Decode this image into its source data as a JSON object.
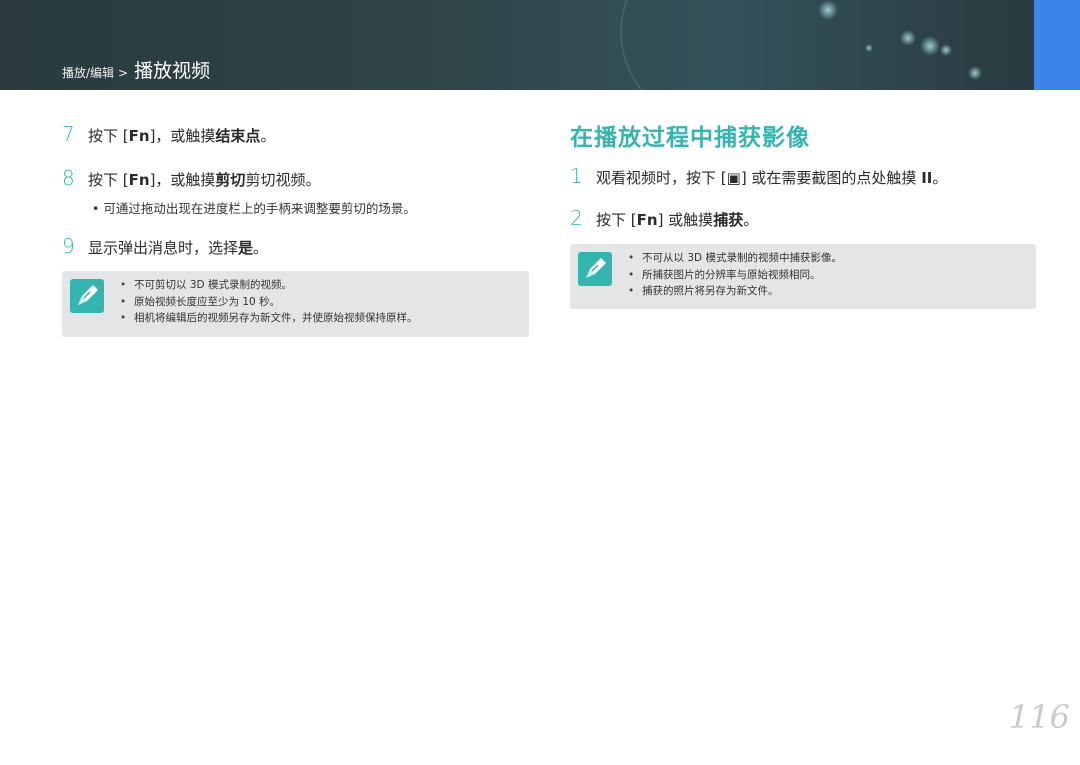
{
  "header": {
    "crumb": "播放/编辑",
    "separator": ">",
    "title": "播放视频"
  },
  "left": {
    "steps": [
      {
        "num": "7",
        "pre": "按下 [",
        "key": "Fn",
        "mid": "]，或触摸",
        "bold": "结束点",
        "post": "。"
      },
      {
        "num": "8",
        "pre": "按下 [",
        "key": "Fn",
        "mid": "]，或触摸",
        "bold": "剪切",
        "post": "剪切视频。"
      },
      {
        "num": "9",
        "pre": "显示弹出消息时，选择",
        "bold": "是",
        "post": "。"
      }
    ],
    "step8_sub": "• 可通过拖动出现在进度栏上的手柄来调整要剪切的场景。",
    "notes": [
      "不可剪切以 3D 模式录制的视频。",
      "原始视频长度应至少为 10 秒。",
      "相机将编辑后的视频另存为新文件，并使原始视频保持原样。"
    ]
  },
  "right": {
    "section_title": "在播放过程中捕获影像",
    "steps": [
      {
        "num": "1",
        "pre": "观看视频时，按下 [",
        "key": "▣",
        "mid": "] 或在需要截图的点处触摸 ",
        "bold": "II",
        "post": "。"
      },
      {
        "num": "2",
        "pre": "按下 [",
        "key": "Fn",
        "mid": "] 或触摸",
        "bold": "捕获",
        "post": "。"
      }
    ],
    "notes": [
      "不可从以 3D 模式录制的视频中捕获影像。",
      "所捕获图片的分辨率与原始视频相同。",
      "捕获的照片将另存为新文件。"
    ]
  },
  "page_number": "116",
  "colors": {
    "accent": "#35b5b0",
    "banner": "#2f4447",
    "tab": "#3d84e8",
    "note_bg": "#e3e5e6"
  },
  "icons": [
    "pencil-note-icon",
    "camera-button-icon"
  ]
}
